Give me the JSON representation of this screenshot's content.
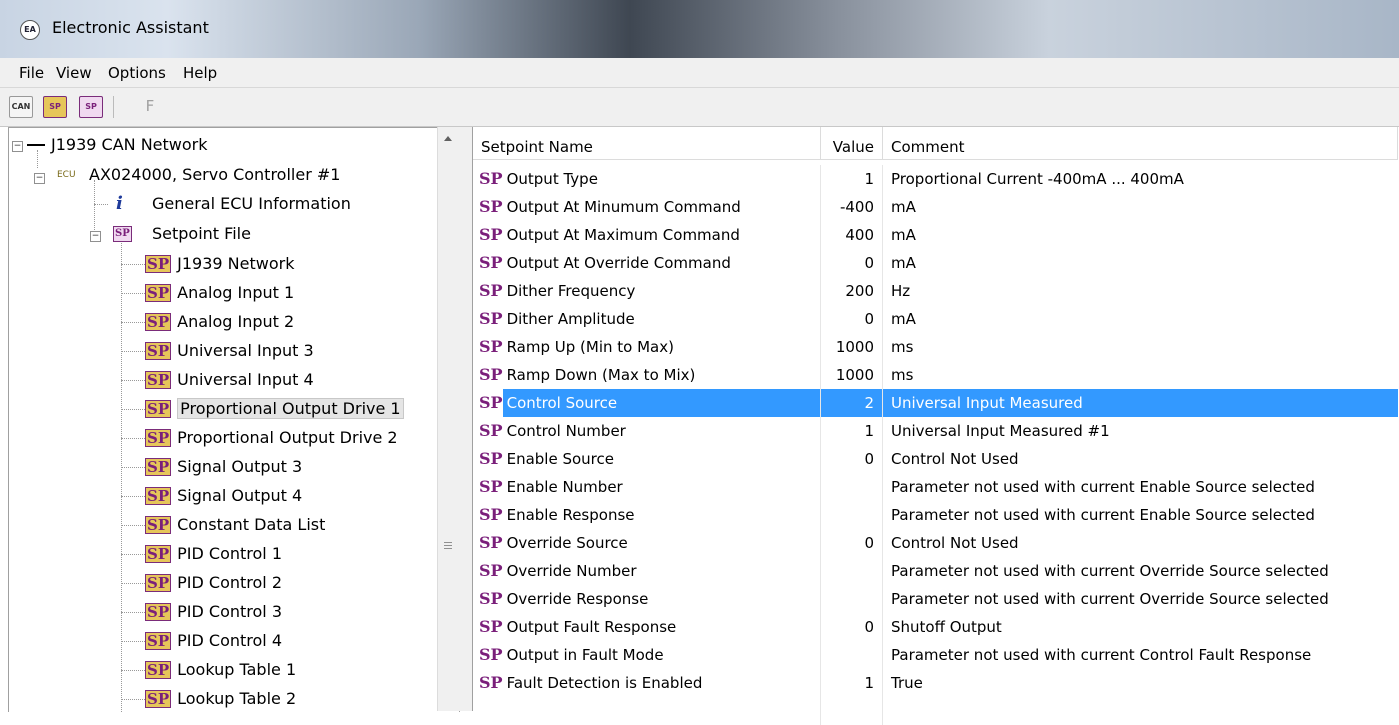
{
  "window": {
    "title": "Electronic Assistant",
    "app_icon": "EA"
  },
  "menu": [
    "File",
    "View",
    "Options",
    "Help"
  ],
  "toolbar": {
    "can_icon": "CAN",
    "sp_icon_1": "SP",
    "sp_icon_2": "SP",
    "f_button": "F"
  },
  "tree": {
    "root": "J1939 CAN Network",
    "ecu": {
      "prefix": "ECU",
      "label": "AX024000, Servo Controller #1"
    },
    "info": {
      "glyph": "i",
      "label": "General ECU Information"
    },
    "setpoint_file": {
      "icon": "SP",
      "label": "Setpoint File"
    },
    "items": [
      "J1939 Network",
      "Analog Input 1",
      "Analog Input 2",
      "Universal Input 3",
      "Universal Input 4",
      "Proportional Output Drive 1",
      "Proportional Output Drive 2",
      "Signal Output 3",
      "Signal Output 4",
      "Constant Data List",
      "PID Control 1",
      "PID Control 2",
      "PID Control 3",
      "PID Control 4",
      "Lookup Table 1",
      "Lookup Table 2"
    ],
    "item_icon": "SP",
    "selected_item_index": 5
  },
  "grid": {
    "columns": [
      "Setpoint Name",
      "Value",
      "Comment"
    ],
    "row_icon": "SP",
    "selected_row_index": 8,
    "rows": [
      {
        "name": "Output Type",
        "value": "1",
        "comment": "Proportional Current -400mA ... 400mA"
      },
      {
        "name": "Output At Minumum Command",
        "value": "-400",
        "comment": "mA"
      },
      {
        "name": "Output At Maximum Command",
        "value": "400",
        "comment": "mA"
      },
      {
        "name": "Output At Override Command",
        "value": "0",
        "comment": "mA"
      },
      {
        "name": "Dither Frequency",
        "value": "200",
        "comment": "Hz"
      },
      {
        "name": "Dither Amplitude",
        "value": "0",
        "comment": "mA"
      },
      {
        "name": "Ramp Up (Min to Max)",
        "value": "1000",
        "comment": "ms"
      },
      {
        "name": "Ramp Down (Max to Mix)",
        "value": "1000",
        "comment": "ms"
      },
      {
        "name": "Control Source",
        "value": "2",
        "comment": "Universal Input Measured"
      },
      {
        "name": "Control Number",
        "value": "1",
        "comment": "Universal Input Measured #1"
      },
      {
        "name": "Enable Source",
        "value": "0",
        "comment": "Control Not Used"
      },
      {
        "name": "Enable Number",
        "value": "",
        "comment": "Parameter not used with current Enable Source selected"
      },
      {
        "name": "Enable Response",
        "value": "",
        "comment": "Parameter not used with current Enable Source selected"
      },
      {
        "name": "Override Source",
        "value": "0",
        "comment": "Control Not Used"
      },
      {
        "name": "Override Number",
        "value": "",
        "comment": "Parameter not used with current Override Source selected"
      },
      {
        "name": "Override Response",
        "value": "",
        "comment": "Parameter not used with current Override Source selected"
      },
      {
        "name": "Output Fault Response",
        "value": "0",
        "comment": "Shutoff Output"
      },
      {
        "name": "Output in Fault Mode",
        "value": "",
        "comment": "Parameter not used with current Control Fault Response"
      },
      {
        "name": "Fault Detection is Enabled",
        "value": "1",
        "comment": "True"
      }
    ]
  },
  "colors": {
    "selection": "#3399ff",
    "sp_purple": "#7a1f7a",
    "sp_gold": "#e6c65a"
  }
}
